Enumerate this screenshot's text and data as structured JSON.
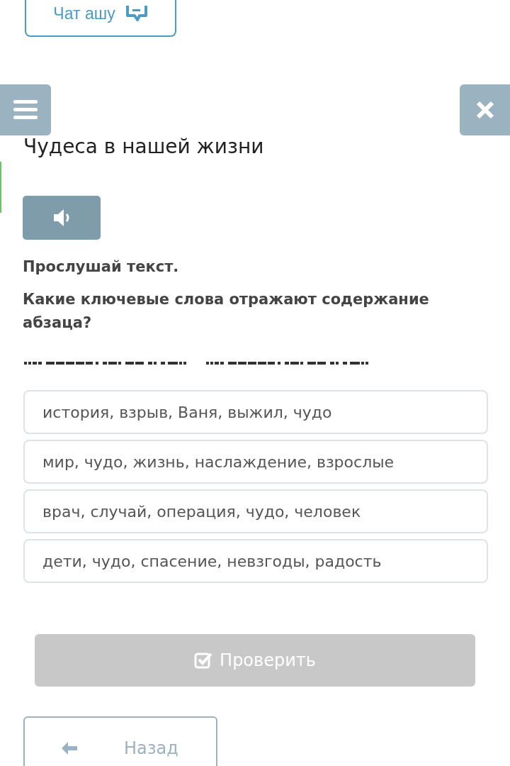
{
  "chat_button": {
    "label": "Чат ашу"
  },
  "title": "Чудеса в нашей жизни",
  "instruction": "Прослушай текст.",
  "question": "Какие ключевые слова отражают содержание абзаца?",
  "options": [
    {
      "text": "история, взрыв, Ваня, выжил, чудо",
      "selected": false
    },
    {
      "text": "мир, чудо, жизнь, наслаждение, взрослые",
      "selected": false
    },
    {
      "text": "врач, случай, операция, чудо, человек",
      "selected": false
    },
    {
      "text": "дети, чудо, спасение, невзгоды, радость",
      "selected": false
    }
  ],
  "check_button": {
    "label": "Проверить",
    "disabled": true
  },
  "back_button": {
    "label": "Назад"
  }
}
